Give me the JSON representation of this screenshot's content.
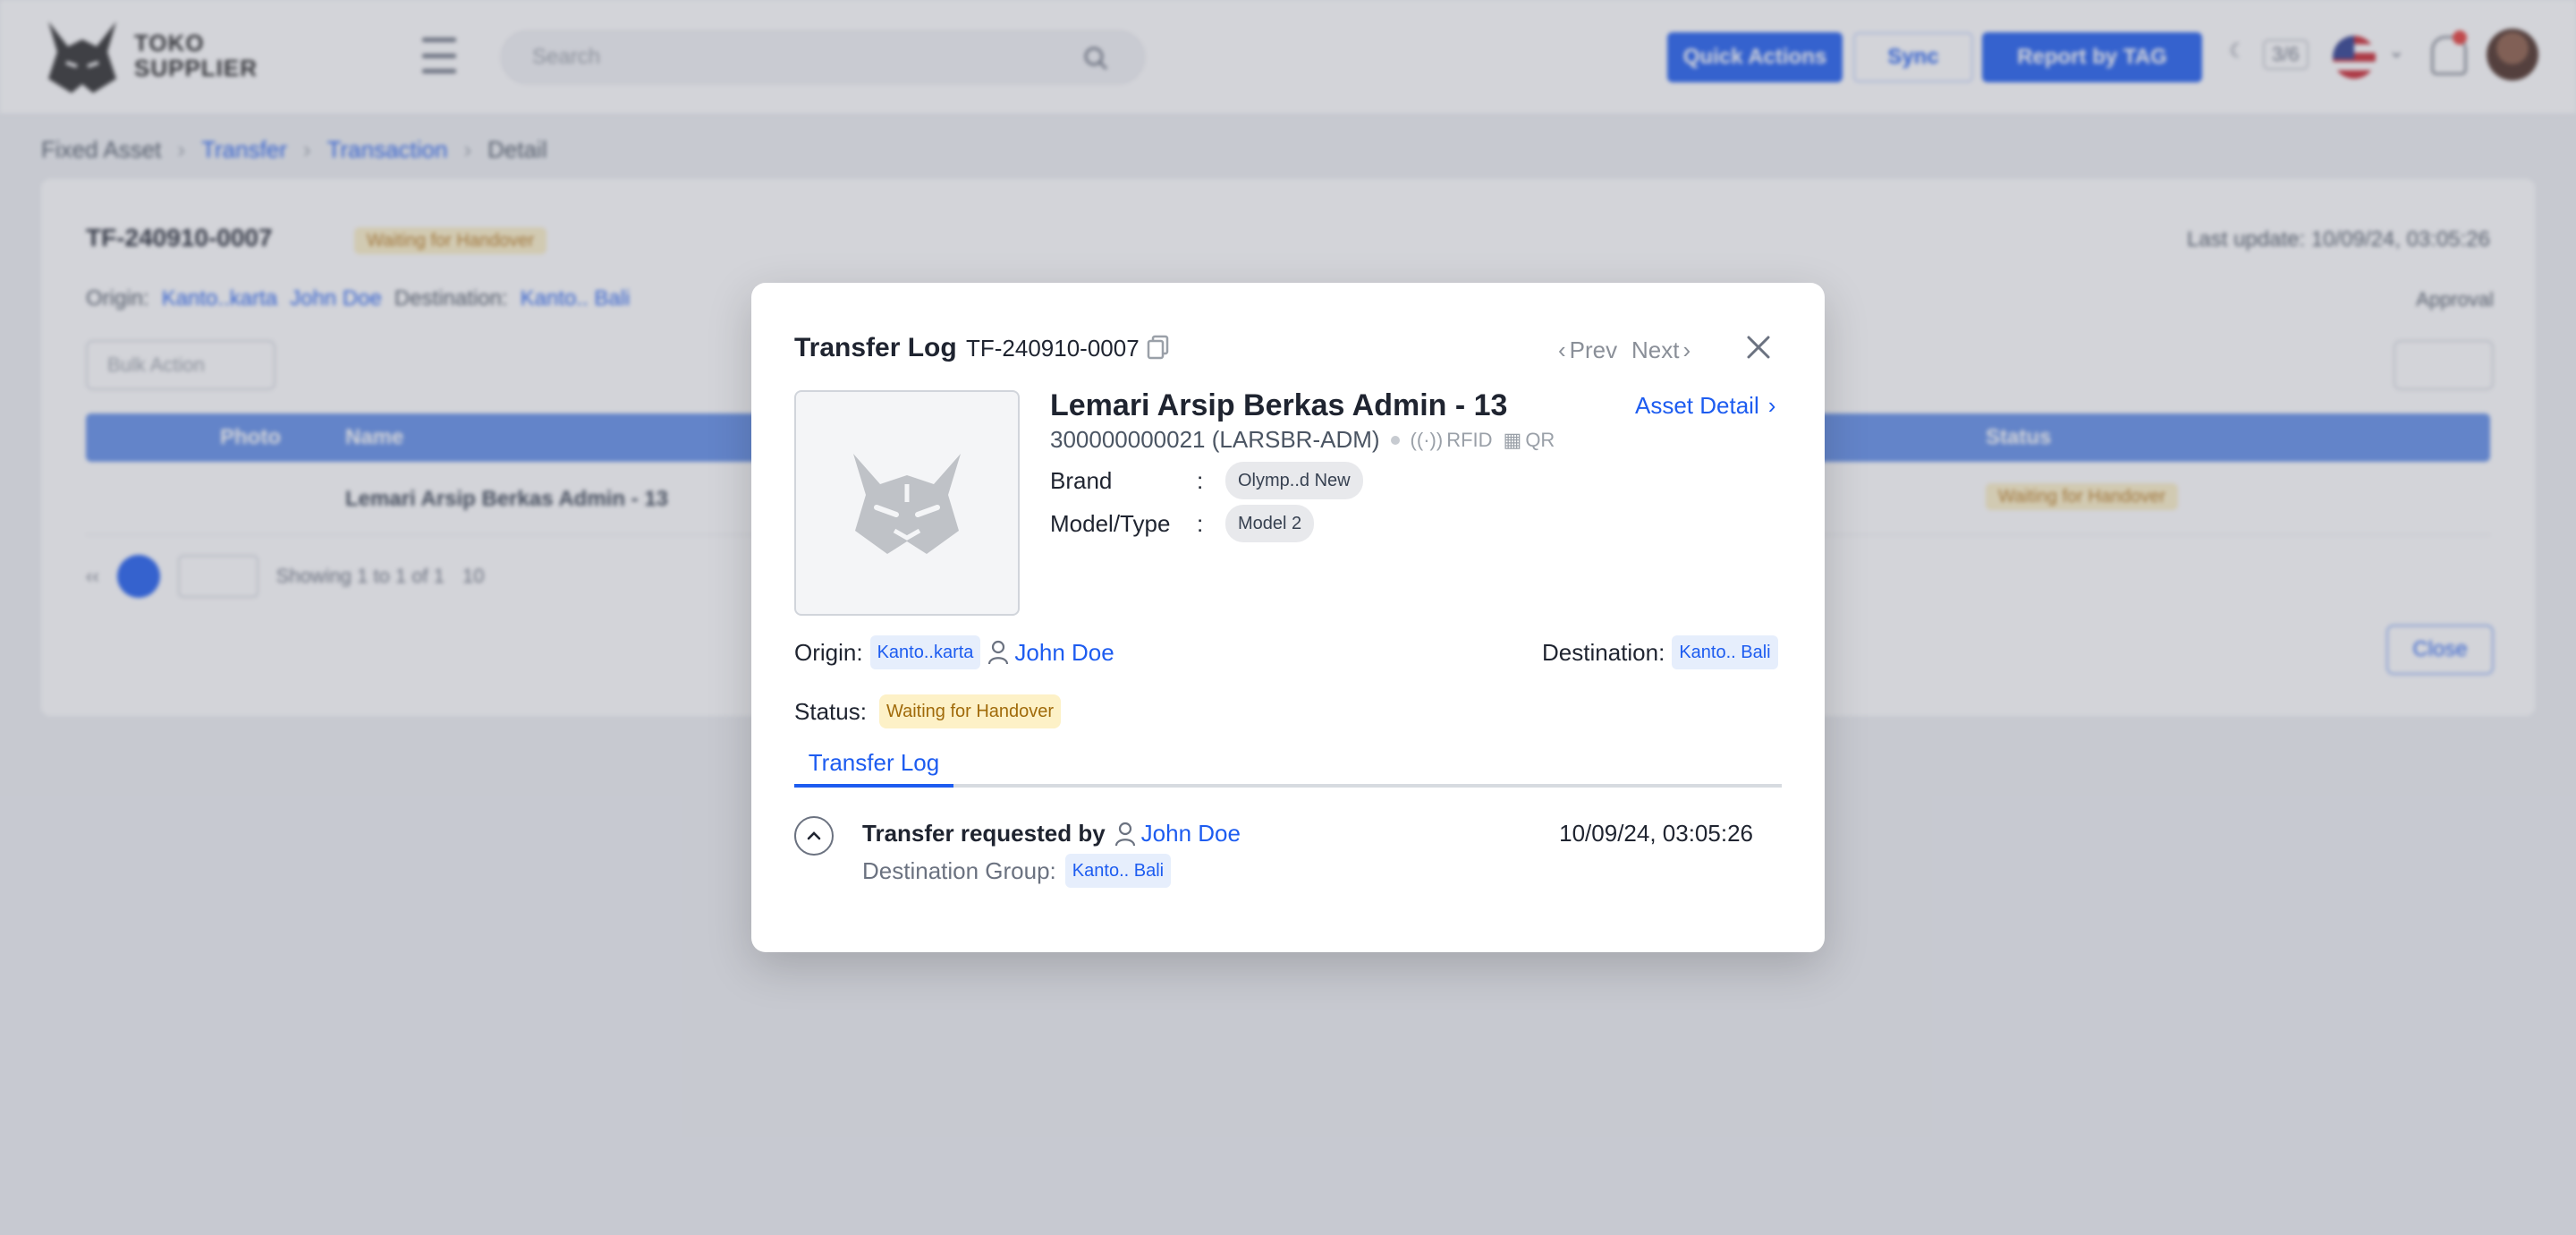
{
  "background": {
    "app_brand": "TOKO\nSUPPLIER",
    "search": {
      "placeholder": "Search"
    },
    "header_buttons": {
      "quick_actions": "Quick Actions",
      "sync": "Sync",
      "report": "Report by TAG"
    },
    "header_misc": {
      "kbd": "3/6"
    },
    "breadcrumb": [
      "Fixed Asset",
      "Transfer",
      "Transaction",
      "Detail"
    ],
    "card": {
      "title": "TF-240910-0007",
      "status": "Waiting for Handover",
      "last_update": "Last update: 10/09/24, 03:05:26",
      "origin_label": "Origin:",
      "origin_value": "Kanto..karta",
      "origin_user": "John Doe",
      "destination_label": "Destination:",
      "destination_value": "Kanto.. Bali",
      "approval": "Approval",
      "bulk_action": "Bulk Action",
      "columns": {
        "photo": "Photo",
        "name": "Name",
        "status": "Status"
      },
      "row": {
        "name": "Lemari Arsip Berkas Admin - 13",
        "status": "Waiting for Handover"
      },
      "pager": {
        "page": "1",
        "showing": "Showing 1 to 1 of 1",
        "per_page": "10"
      },
      "close": "Close"
    }
  },
  "modal": {
    "title": "Transfer Log",
    "code": "TF-240910-0007",
    "prev": "Prev",
    "next": "Next",
    "asset": {
      "name": "Lemari Arsip Berkas Admin - 13",
      "detail_link": "Asset Detail",
      "code": "300000000021 (LARSBR-ADM)",
      "rfid": "RFID",
      "qr": "QR",
      "brand_label": "Brand",
      "brand_value": "Olymp..d New",
      "model_label": "Model/Type",
      "model_value": "Model 2"
    },
    "origin_label": "Origin:",
    "origin_value": "Kanto..karta",
    "origin_user": "John Doe",
    "destination_label": "Destination:",
    "destination_value": "Kanto.. Bali",
    "status_label": "Status:",
    "status_value": "Waiting for Handover",
    "tabs": [
      "Transfer Log"
    ],
    "log": {
      "title": "Transfer requested by",
      "user": "John Doe",
      "time": "10/09/24, 03:05:26",
      "sub_label": "Destination Group:",
      "sub_value": "Kanto.. Bali"
    }
  },
  "colors": {
    "accent": "#1d5cf0",
    "warning_bg": "#fdf1c7",
    "warning_text": "#a06a0a",
    "chip_blue_bg": "#e6eefc"
  }
}
